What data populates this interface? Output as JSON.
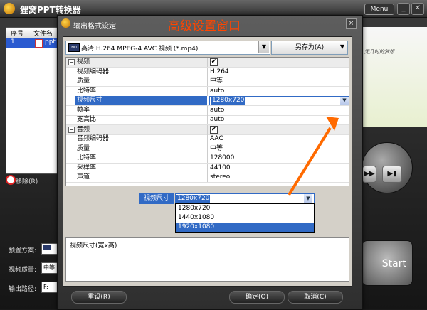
{
  "app": {
    "title": "狸窝PPT转换器",
    "menu_label": "Menu",
    "minimize": "_",
    "close": "✕",
    "list": {
      "col_index": "序号",
      "col_filename": "文件名",
      "row_index": "1",
      "row_file": "ppt"
    },
    "remove_label": "移除(R)",
    "preview_text": "无几时的梦想",
    "bottom": {
      "preset_label": "预置方案:",
      "quality_label": "视频质量:",
      "quality_value": "中等",
      "path_label": "输出路径:",
      "path_value": "F:"
    },
    "start_label": "Start"
  },
  "dialog": {
    "title": "输出格式设定",
    "annotation": "高级设置窗口",
    "close": "×",
    "preset_value": "高清 H.264 MPEG-4 AVC 视频 (*.mp4)",
    "save_as": "另存为(A)",
    "properties": [
      {
        "name": "视频",
        "value": "✔",
        "kind": "category",
        "expander": "−"
      },
      {
        "name": "视频编码器",
        "value": "H.264"
      },
      {
        "name": "质量",
        "value": "中等"
      },
      {
        "name": "比特率",
        "value": "auto"
      },
      {
        "name": "视频尺寸",
        "value": "1280x720",
        "kind": "selected"
      },
      {
        "name": "帧率",
        "value": "auto"
      },
      {
        "name": "宽高比",
        "value": "auto"
      },
      {
        "name": "音频",
        "value": "✔",
        "kind": "category",
        "expander": "−"
      },
      {
        "name": "音频编码器",
        "value": "AAC"
      },
      {
        "name": "质量",
        "value": "中等"
      },
      {
        "name": "比特率",
        "value": "128000"
      },
      {
        "name": "采样率",
        "value": "44100"
      },
      {
        "name": "声道",
        "value": "stereo"
      }
    ],
    "zoom": {
      "label": "视频尺寸",
      "value": "1280x720",
      "options": [
        "1280x720",
        "1440x1080",
        "1920x1080"
      ],
      "highlighted_index": 2
    },
    "description": "视频尺寸(宽x高)",
    "reset": "重设(R)",
    "ok": "确定(O)",
    "cancel": "取消(C)"
  },
  "colors": {
    "accent": "#316ac5",
    "annotation": "#ff4500",
    "arrow": "#ff6a00"
  }
}
